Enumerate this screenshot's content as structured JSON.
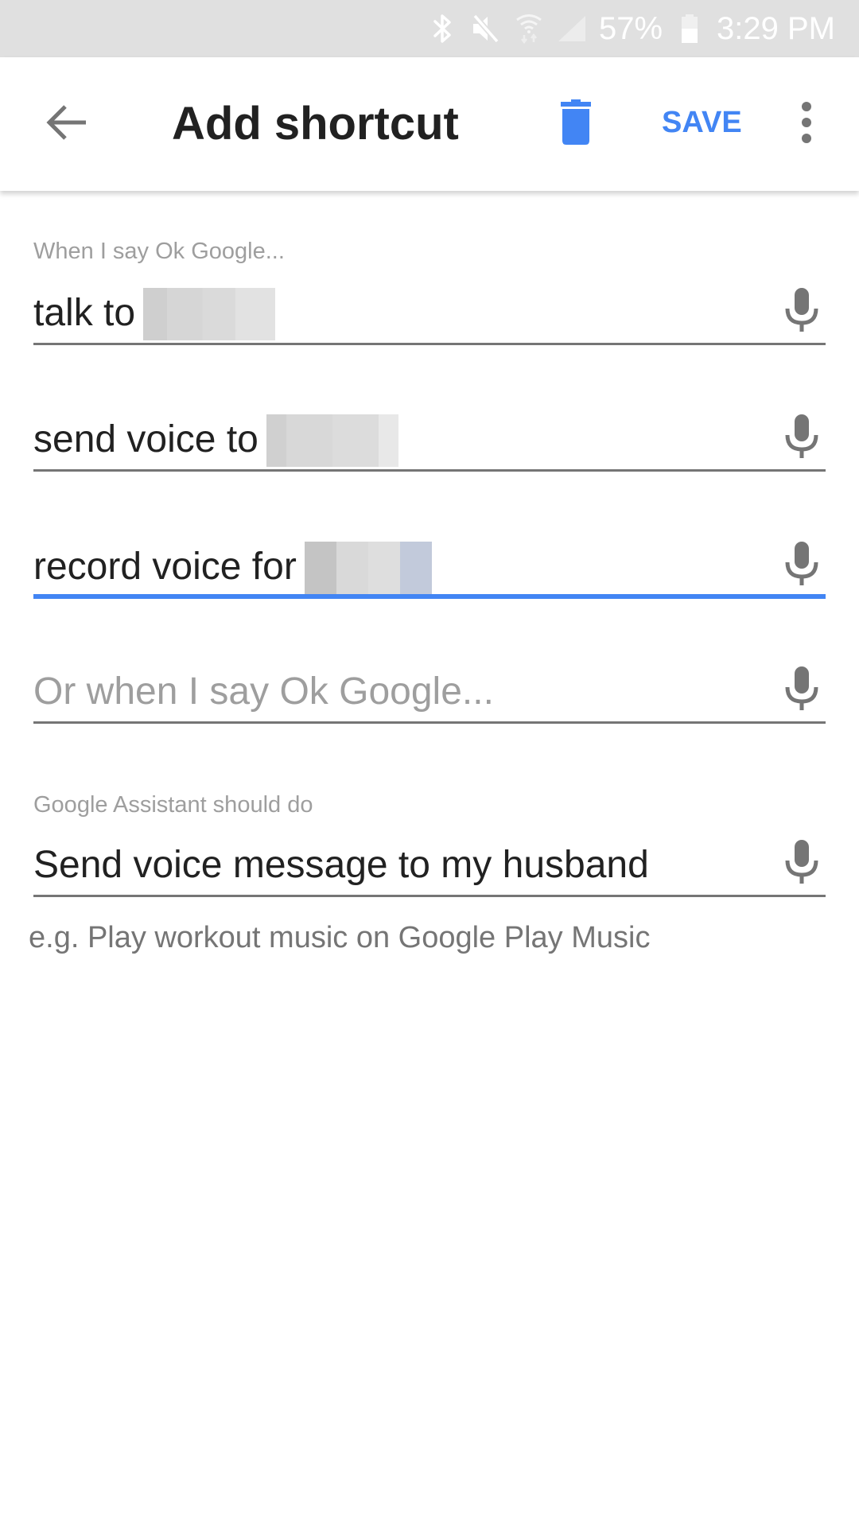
{
  "status_bar": {
    "icons": [
      "bluetooth-icon",
      "mute-icon",
      "wifi-icon",
      "signal-icon",
      "battery-icon"
    ],
    "battery_percent": "57%",
    "time": "3:29 PM"
  },
  "toolbar": {
    "back_icon": "arrow-left-icon",
    "title": "Add shortcut",
    "delete_icon": "trash-icon",
    "save_label": "SAVE",
    "more_icon": "more-vertical-icon"
  },
  "form": {
    "trigger_label": "When I say Ok Google...",
    "triggers": [
      {
        "value": "talk to",
        "redacted": true,
        "focused": false
      },
      {
        "value": "send voice to",
        "redacted": true,
        "focused": false
      },
      {
        "value": "record voice for",
        "redacted": true,
        "focused": true
      }
    ],
    "additional_trigger_placeholder": "Or when I say Ok Google...",
    "action_label": "Google Assistant should do",
    "action_value": "Send voice message to my husband",
    "action_helper": "e.g. Play workout music on Google Play Music",
    "mic_icon": "microphone-icon"
  },
  "colors": {
    "accent": "#4285f4",
    "status_bar_bg": "#e0e0e0",
    "text_primary": "#212121",
    "text_hint": "#9e9e9e",
    "underline": "#757575"
  }
}
